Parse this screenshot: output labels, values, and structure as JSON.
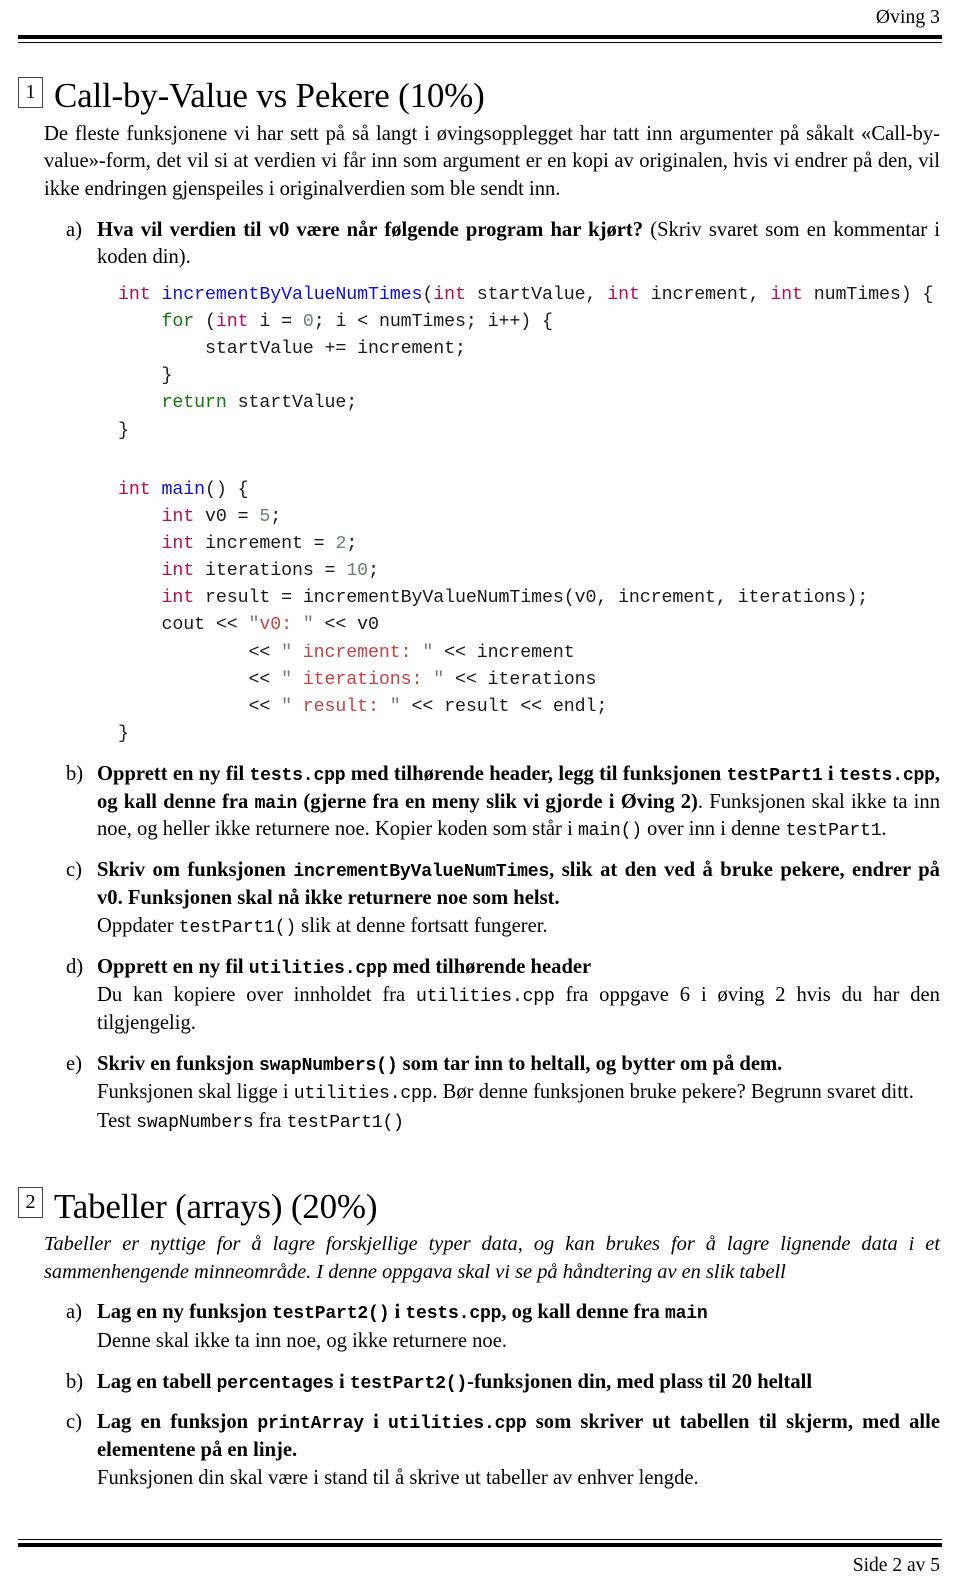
{
  "header": {
    "running_head": "Øving 3"
  },
  "footer": {
    "page_label": "Side 2 av 5"
  },
  "sections": [
    {
      "number": "1",
      "title": "Call-by-Value vs Pekere (10%)",
      "intro": "De fleste funksjonene vi har sett på så langt i øvingsopplegget har tatt inn argumenter på såkalt «Call-by-value»-form, det vil si at verdien vi får inn som argument er en kopi av originalen, hvis vi endrer på den, vil ikke endringen gjenspeiles i originalverdien som ble sendt inn.",
      "items": {
        "a": {
          "marker": "a)",
          "bold_lead": "Hva vil verdien til v0 være når følgende program har kjørt?",
          "tail": " (Skriv svaret som en kommentar i koden din)."
        },
        "b": {
          "marker": "b)",
          "bold_1": "Opprett en ny fil ",
          "code_1": "tests.cpp",
          "bold_2": " med tilhørende header, legg til funksjonen ",
          "code_2": "testPart1",
          "bold_3": " i ",
          "code_3": "tests.cpp",
          "bold_4": ", og kall denne fra ",
          "code_4": "main",
          "bold_5": " (gjerne fra en meny slik vi gjorde i Øving 2)",
          "tail_1": ". Funksjonen skal ikke ta inn noe, og heller ikke returnere noe. Kopier koden som står i ",
          "code_5": "main()",
          "tail_2": " over inn i denne ",
          "code_6": "testPart1",
          "tail_3": "."
        },
        "c": {
          "marker": "c)",
          "bold_1": "Skriv om funksjonen ",
          "code_1": "incrementByValueNumTimes",
          "bold_2": ", slik at den ved å bruke pekere, endrer på v0. Funksjonen skal nå ikke returnere noe som helst.",
          "sub_1": "Oppdater ",
          "sub_code": "testPart1()",
          "sub_2": " slik at denne fortsatt fungerer."
        },
        "d": {
          "marker": "d)",
          "bold_1": "Opprett en ny fil ",
          "code_1": "utilities.cpp",
          "bold_2": " med tilhørende header",
          "sub_1": "Du kan kopiere over innholdet fra ",
          "sub_code": "utilities.cpp",
          "sub_2": " fra oppgave 6 i øving 2 hvis du har den tilgjengelig."
        },
        "e": {
          "marker": "e)",
          "bold_1": "Skriv en funksjon ",
          "code_1": "swapNumbers()",
          "bold_2": " som tar inn to heltall, og bytter om på dem.",
          "sub_1": "Funksjonen skal ligge i ",
          "sub_code_1": "utilities.cpp",
          "sub_2": ".  Bør denne funksjonen bruke pekere?  Begrunn svaret ditt.",
          "sub2_1": "Test ",
          "sub2_code_1": "swapNumbers",
          "sub2_2": " fra ",
          "sub2_code_2": "testPart1()"
        }
      }
    },
    {
      "number": "2",
      "title": "Tabeller (arrays) (20%)",
      "intro_italic": "Tabeller er nyttige for å lagre forskjellige typer data, og kan brukes for å lagre lignende data i et sammenhengende minneområde.  I denne oppgava skal vi se på håndtering av en slik tabell",
      "items": {
        "a": {
          "marker": "a)",
          "bold_1": "Lag en ny funksjon ",
          "code_1": "testPart2()",
          "bold_2": " i ",
          "code_2": "tests.cpp",
          "bold_3": ", og kall denne fra ",
          "code_3": "main",
          "sub_1": "Denne skal ikke ta inn noe, og ikke returnere noe."
        },
        "b": {
          "marker": "b)",
          "bold_1": "Lag en tabell ",
          "code_1": "percentages",
          "bold_2": " i ",
          "code_2": "testPart2()",
          "bold_3": "-funksjonen din, med plass til 20 heltall"
        },
        "c": {
          "marker": "c)",
          "bold_1": "Lag en funksjon ",
          "code_1": "printArray",
          "bold_2": " i ",
          "code_2": "utilities.cpp",
          "bold_3": " som skriver ut tabellen til skjerm, med alle elementene på en linje.",
          "sub_1": "Funksjonen din skal være i stand til å skrive ut tabeller av enhver lengde."
        }
      }
    }
  ],
  "code_blocks": {
    "function_def": {
      "l1_kw": "int",
      "l1_fn": "incrementByValueNumTimes",
      "l1_open": "(",
      "l1_t1": "int",
      "l1_p1": " startValue, ",
      "l1_t2": "int",
      "l1_p2": " increment, ",
      "l1_t3": "int",
      "l1_p3": " numTimes) {",
      "l2_kw": "for",
      "l2_a": " (",
      "l2_t": "int",
      "l2_b": " i = ",
      "l2_n": "0",
      "l2_c": "; i < numTimes; i++) {",
      "l3": "        startValue += increment;",
      "l4": "    }",
      "l5_kw": "return",
      "l5_rest": " startValue;",
      "l6": "}"
    },
    "main_def": {
      "m1_kw": "int",
      "m1_fn": "main",
      "m1_rest": "() {",
      "m2_kw": "int",
      "m2_a": " v0 = ",
      "m2_n": "5",
      "m2_b": ";",
      "m3_kw": "int",
      "m3_a": " increment = ",
      "m3_n": "2",
      "m3_b": ";",
      "m4_kw": "int",
      "m4_a": " iterations = ",
      "m4_n": "10",
      "m4_b": ";",
      "m5_kw": "int",
      "m5_a": " result = incrementByValueNumTimes(v0, increment, iterations);",
      "m6_a": "    cout << ",
      "m6_q1": "\"",
      "m6_s": "v0: ",
      "m6_q2": "\"",
      "m6_b": " << v0",
      "m7_a": "            << ",
      "m7_q1": "\"",
      "m7_s": " increment: ",
      "m7_q2": "\"",
      "m7_b": " << increment",
      "m8_a": "            << ",
      "m8_q1": "\"",
      "m8_s": " iterations: ",
      "m8_q2": "\"",
      "m8_b": " << iterations",
      "m9_a": "            << ",
      "m9_q1": "\"",
      "m9_s": " result: ",
      "m9_q2": "\"",
      "m9_b": " << result << endl;",
      "m10": "}"
    }
  },
  "colors": {
    "keyword_type": "#b0105c",
    "keyword_control": "#117711",
    "function_name": "#1010c8",
    "number_literal": "#6f7f6f",
    "string_literal": "#c04545",
    "text": "#000000"
  }
}
